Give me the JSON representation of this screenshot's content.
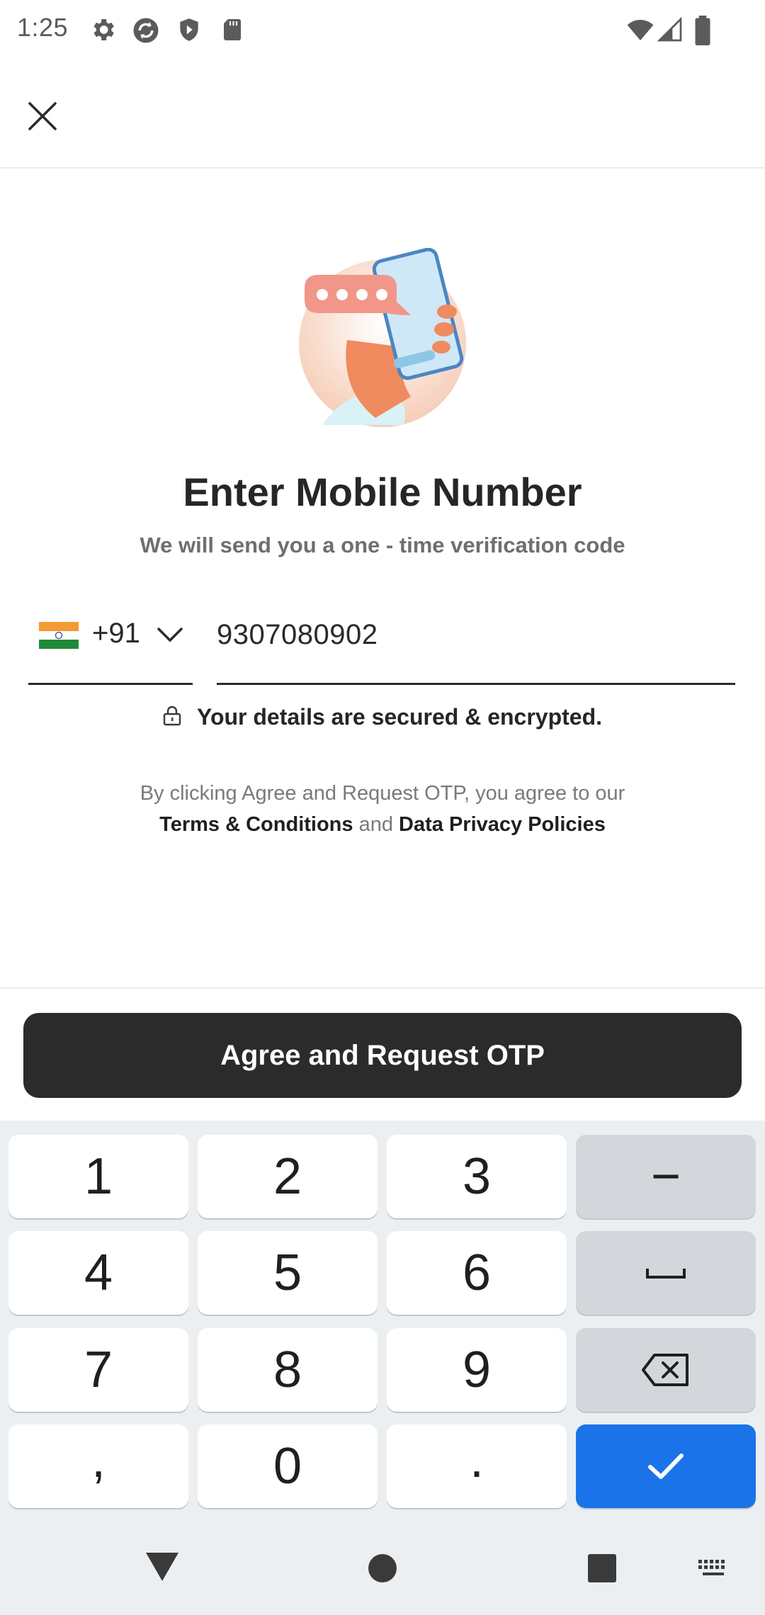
{
  "status_bar": {
    "time": "1:25",
    "left_icons": [
      "gear-icon",
      "sync-icon",
      "shield-icon",
      "sd-card-icon"
    ],
    "right_icons": [
      "wifi-icon",
      "signal-icon",
      "battery-icon"
    ]
  },
  "header": {
    "close_icon": "close-icon"
  },
  "main": {
    "title": "Enter Mobile Number",
    "subtitle": "We will send you a one - time verification code",
    "country_code": "+91",
    "country_flag": "india-flag-icon",
    "phone_number": "9307080902",
    "secure_text": "Your details are secured & encrypted.",
    "terms_line1": "By clicking Agree and Request OTP, you agree to our",
    "terms_link": "Terms & Conditions",
    "terms_and": "and",
    "privacy_link": "Data Privacy Policies"
  },
  "action": {
    "button_label": "Agree and Request OTP"
  },
  "keyboard": {
    "rows": [
      [
        "1",
        "2",
        "3",
        "−"
      ],
      [
        "4",
        "5",
        "6",
        "space-icon"
      ],
      [
        "7",
        "8",
        "9",
        "backspace-icon"
      ],
      [
        ",",
        "0",
        ".",
        "check-icon"
      ]
    ]
  },
  "nav_bar": {
    "icons": [
      "back-icon",
      "home-icon",
      "recents-icon",
      "keyboard-icon"
    ]
  },
  "colors": {
    "button_bg": "#2b2b2b",
    "enter_key": "#1a73e8",
    "keyboard_bg": "#eceff2"
  }
}
